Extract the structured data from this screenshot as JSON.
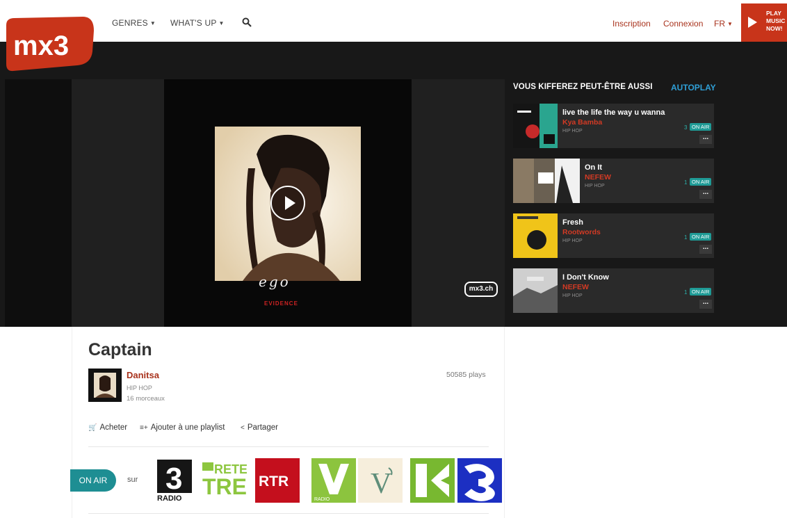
{
  "header": {
    "logo_text": "mx3",
    "nav": [
      {
        "label": "GENRES"
      },
      {
        "label": "WHAT'S UP"
      }
    ],
    "login_links": {
      "signup": "Inscription",
      "login": "Connexion",
      "lang": "FR"
    },
    "play_now": "PLAY\nMUSIC\nNOW!",
    "colors": {
      "brand": "#c8341a",
      "link": "#a8321c",
      "accent": "#2f9fd6",
      "teal": "#1f9b96"
    }
  },
  "player": {
    "cover_title": "ego",
    "cover_label": "EVIDENCE",
    "watermark": "mx3.ch"
  },
  "suggestions": {
    "title": "VOUS KIFFEREZ PEUT-ÊTRE AUSSI",
    "autoplay": "AUTOPLAY",
    "items": [
      {
        "title": "live the life the way u wanna",
        "artist": "Kya Bamba",
        "genre": "HIP HOP",
        "count": "3",
        "onair": "ON AIR",
        "more": "..."
      },
      {
        "title": "On It",
        "artist": "NEFEW",
        "genre": "HIP HOP",
        "count": "1",
        "onair": "ON AIR",
        "more": "..."
      },
      {
        "title": "Fresh",
        "artist": "Rootwords",
        "genre": "HIP HOP",
        "count": "1",
        "onair": "ON AIR",
        "more": "..."
      },
      {
        "title": "I Don't Know",
        "artist": "NEFEW",
        "genre": "HIP HOP",
        "count": "1",
        "onair": "ON AIR",
        "more": "..."
      }
    ]
  },
  "song": {
    "title": "Captain",
    "artist": "Danitsa",
    "genre": "HIP HOP",
    "tracks": "16 morceaux",
    "plays": "50585 plays",
    "actions": {
      "buy": "Acheter",
      "playlist": "Ajouter à une playlist",
      "share": "Partager"
    }
  },
  "onair": {
    "badge": "ON AIR",
    "sur": "sur",
    "stations": [
      {
        "name": "Radio SRF 3",
        "label": "RADIO"
      },
      {
        "name": "RSI Rete Tre",
        "label": "RETE TRE"
      },
      {
        "name": "RTR",
        "label": "RTR"
      },
      {
        "name": "Radio SRF Virus",
        "label": "RADIO"
      },
      {
        "name": "Couleur 3 V",
        "label": "V"
      },
      {
        "name": "Radio Swiss Pop",
        "label": ""
      },
      {
        "name": "RTS 3",
        "label": ""
      }
    ]
  }
}
